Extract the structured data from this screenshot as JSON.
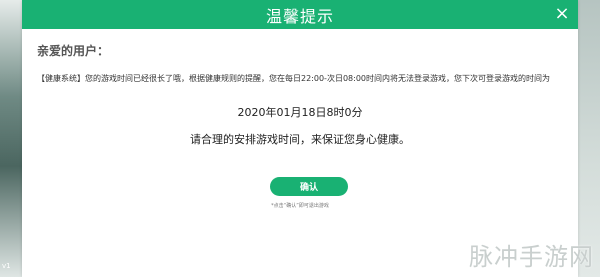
{
  "dialog": {
    "title": "温馨提示",
    "close_icon": "×",
    "greeting": "亲爱的用户：",
    "notice": "【健康系统】您的游戏时间已经很长了哦，根据健康规则的提醒，您在每日22:00-次日08:00时间内将无法登录游戏，您下次可登录游戏的时间为",
    "datetime": "2020年01月18日8时0分",
    "advice": "请合理的安排游戏时间，来保证您身心健康。",
    "confirm_label": "确认",
    "hint": "*点击“确认”即可退出游戏"
  },
  "watermark": "脉冲手游网",
  "left_label": "v1",
  "colors": {
    "accent": "#19b173",
    "title_text": "#ffffff",
    "body_text": "#333333"
  }
}
